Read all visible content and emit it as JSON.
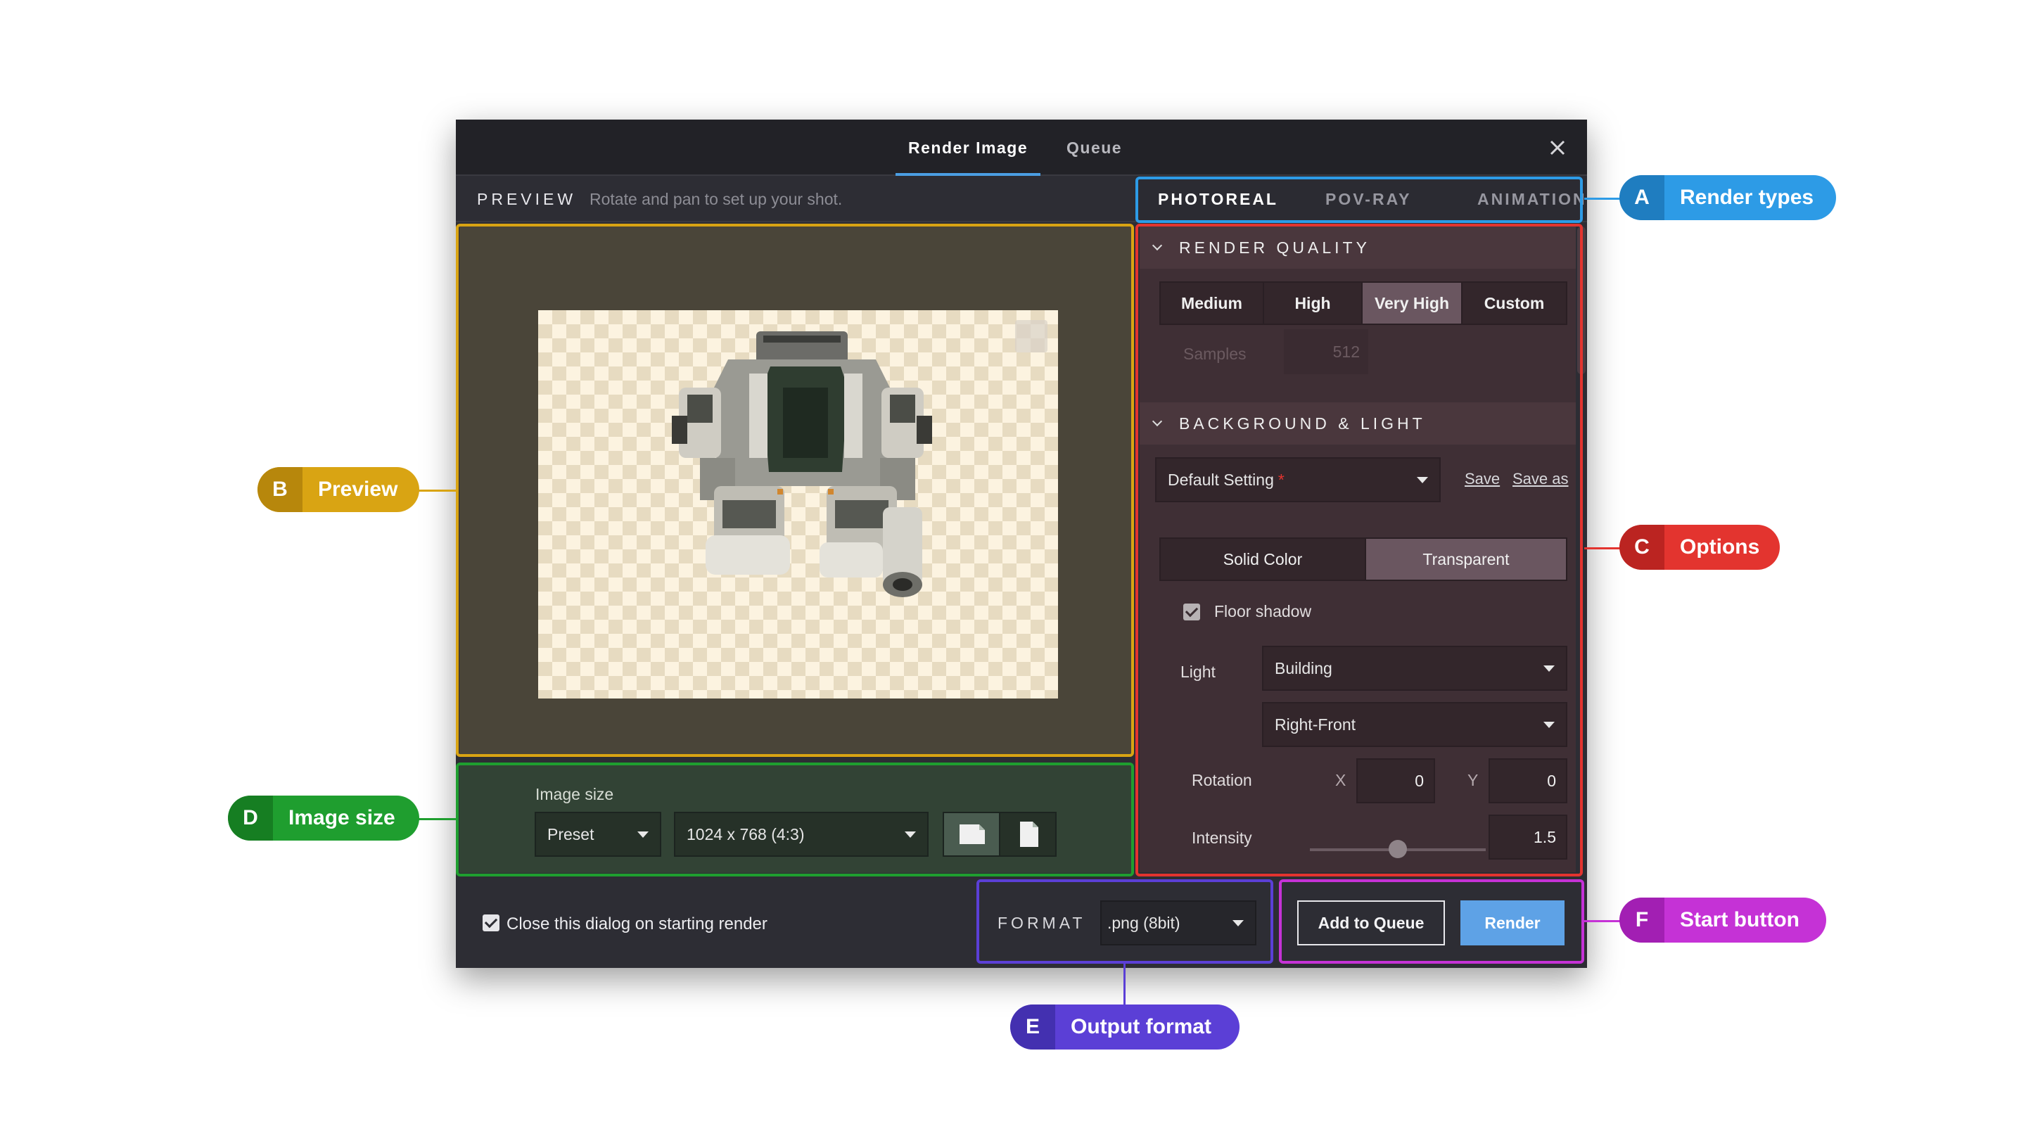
{
  "window": {
    "tabs": [
      {
        "label": "Render Image",
        "active": true
      },
      {
        "label": "Queue",
        "active": false
      }
    ],
    "close_icon": "close-icon"
  },
  "preview": {
    "title": "PREVIEW",
    "hint": "Rotate and pan to set up your shot."
  },
  "render_types": [
    {
      "label": "PHOTOREAL",
      "active": true
    },
    {
      "label": "POV-RAY",
      "active": false
    },
    {
      "label": "ANIMATION",
      "active": false
    }
  ],
  "render_quality": {
    "title": "RENDER QUALITY",
    "options": [
      "Medium",
      "High",
      "Very High",
      "Custom"
    ],
    "selected": "Very High",
    "samples_label": "Samples",
    "samples_value": "512"
  },
  "background_light": {
    "title": "BACKGROUND & LIGHT",
    "preset": "Default Setting",
    "preset_marker": "*",
    "save_label": "Save",
    "save_as_label": "Save as",
    "bg_options": [
      "Solid Color",
      "Transparent"
    ],
    "bg_selected": "Transparent",
    "floor_shadow_label": "Floor shadow",
    "floor_shadow_checked": true,
    "light_label": "Light",
    "light_value": "Building",
    "light_direction": "Right-Front",
    "rotation_label": "Rotation",
    "x_label": "X",
    "x_value": "0",
    "y_label": "Y",
    "y_value": "0",
    "intensity_label": "Intensity",
    "intensity_value": "1.5"
  },
  "image_size": {
    "label": "Image size",
    "preset": "Preset",
    "resolution": "1024 x 768 (4:3)"
  },
  "footer": {
    "close_on_render_label": "Close this dialog on starting render",
    "close_on_render_checked": true,
    "format_label": "FORMAT",
    "format_value": ".png (8bit)",
    "add_to_queue_label": "Add to Queue",
    "render_label": "Render"
  },
  "annotations": [
    {
      "letter": "A",
      "name": "Render types",
      "color": "#2d9be6"
    },
    {
      "letter": "B",
      "name": "Preview",
      "color": "#d9a413"
    },
    {
      "letter": "C",
      "name": "Options",
      "color": "#e3342f"
    },
    {
      "letter": "D",
      "name": "Image size",
      "color": "#1f9e2f"
    },
    {
      "letter": "E",
      "name": "Output format",
      "color": "#5b3fd6"
    },
    {
      "letter": "F",
      "name": "Start button",
      "color": "#c532d6"
    }
  ]
}
